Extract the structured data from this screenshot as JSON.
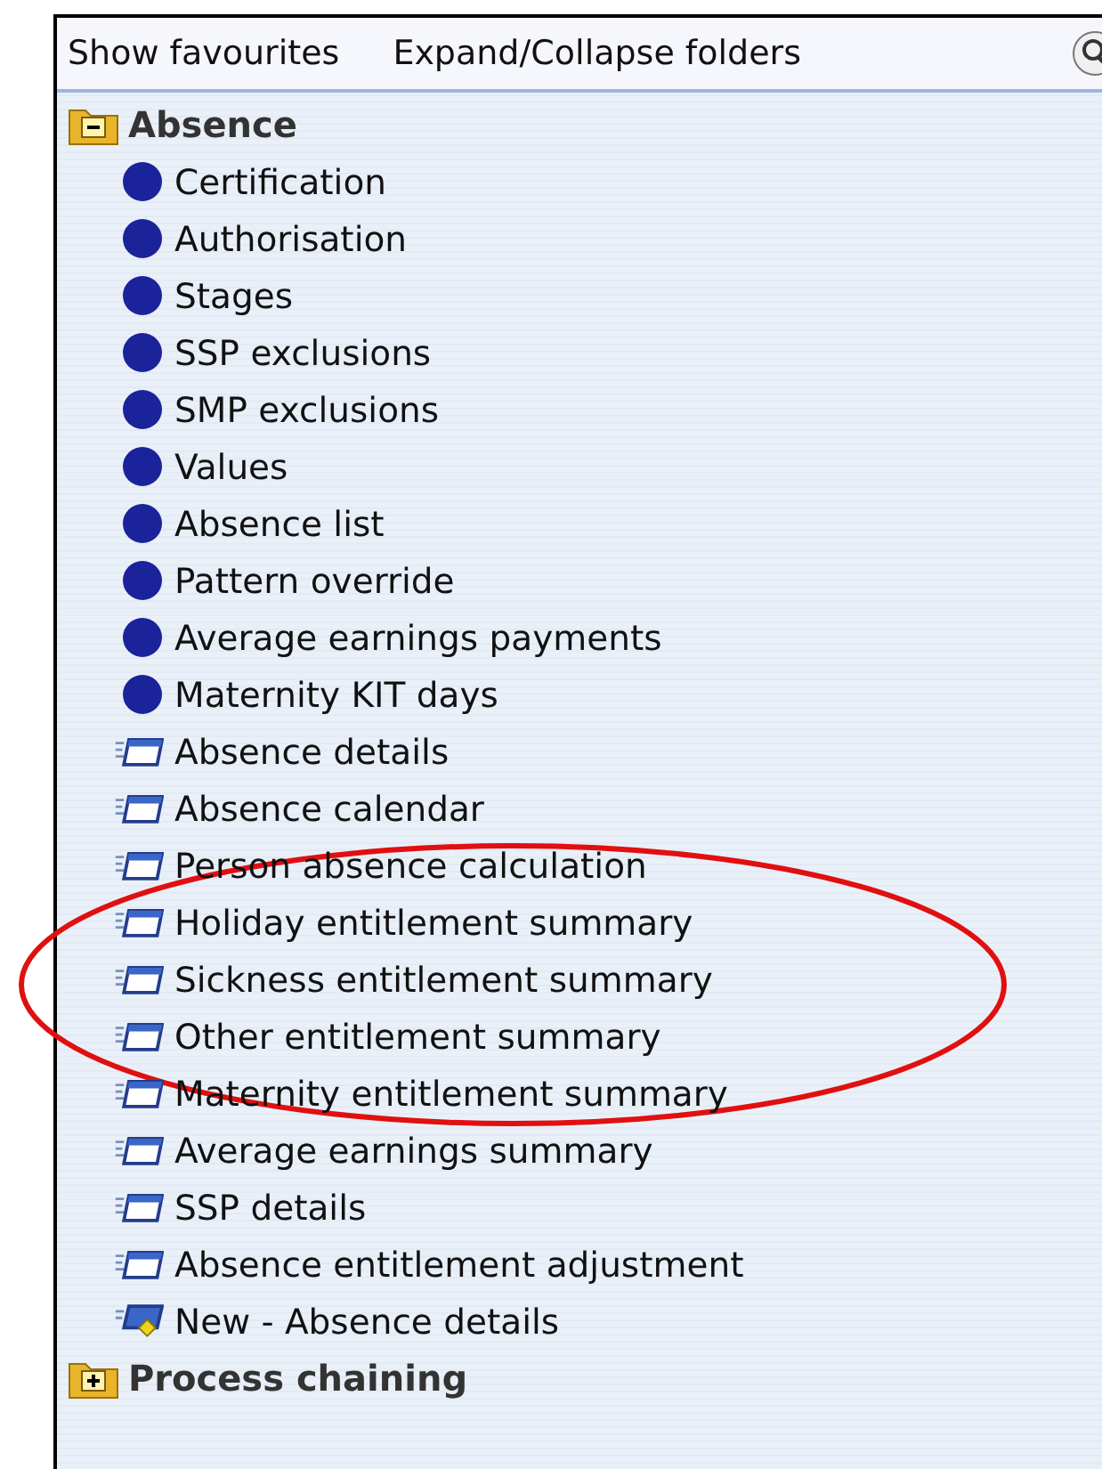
{
  "toolbar": {
    "buttons": [
      "Show favourites",
      "Expand/Collapse folders"
    ]
  },
  "tree": [
    {
      "label": "Absence",
      "expanded": true,
      "children": [
        {
          "label": "Certification",
          "kind": "dot"
        },
        {
          "label": "Authorisation",
          "kind": "dot"
        },
        {
          "label": "Stages",
          "kind": "dot"
        },
        {
          "label": "SSP exclusions",
          "kind": "dot"
        },
        {
          "label": "SMP exclusions",
          "kind": "dot"
        },
        {
          "label": "Values",
          "kind": "dot"
        },
        {
          "label": "Absence list",
          "kind": "dot"
        },
        {
          "label": "Pattern override",
          "kind": "dot"
        },
        {
          "label": "Average earnings payments",
          "kind": "dot"
        },
        {
          "label": "Maternity KIT days",
          "kind": "dot"
        },
        {
          "label": "Absence details",
          "kind": "form"
        },
        {
          "label": "Absence calendar",
          "kind": "form"
        },
        {
          "label": "Person absence calculation",
          "kind": "form"
        },
        {
          "label": "Holiday entitlement summary",
          "kind": "form"
        },
        {
          "label": "Sickness entitlement summary",
          "kind": "form"
        },
        {
          "label": "Other entitlement summary",
          "kind": "form"
        },
        {
          "label": "Maternity entitlement summary",
          "kind": "form"
        },
        {
          "label": "Average earnings summary",
          "kind": "form"
        },
        {
          "label": "SSP details",
          "kind": "form"
        },
        {
          "label": "Absence entitlement adjustment",
          "kind": "form"
        },
        {
          "label": "New - Absence details",
          "kind": "new-form"
        }
      ]
    },
    {
      "label": "Process chaining",
      "expanded": false
    }
  ]
}
